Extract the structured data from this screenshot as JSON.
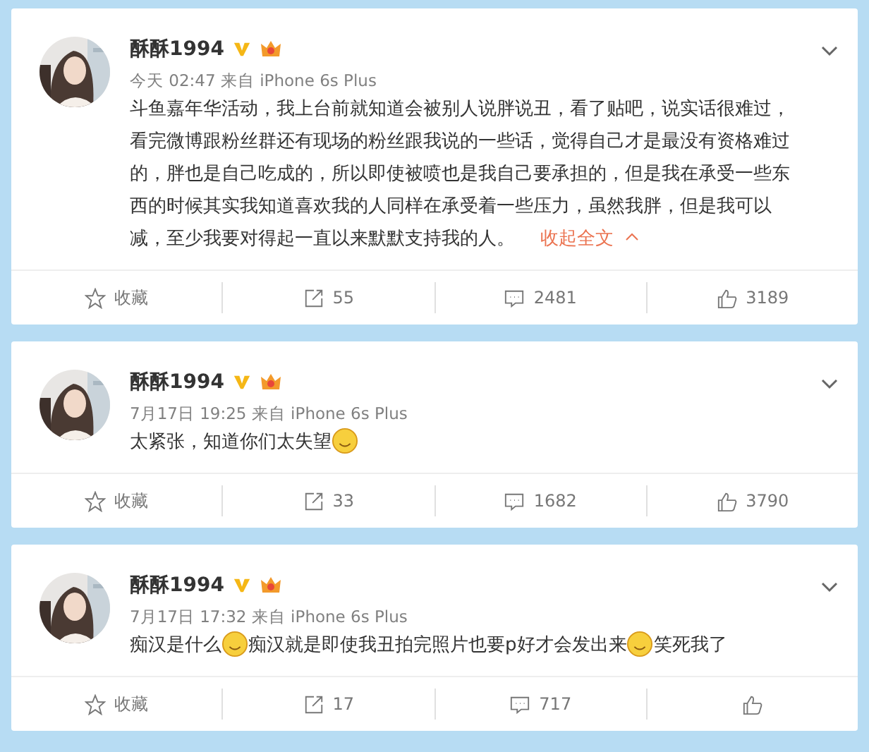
{
  "posts": [
    {
      "author": "酥酥1994",
      "time": "今天 02:47 来自 iPhone 6s Plus",
      "content": [
        {
          "kind": "text",
          "text": "斗鱼嘉年华活动，我上台前就知道会被别人说胖说丑，看了贴吧，说实话很难过，看完微博跟粉丝群还有现场的粉丝跟我说的一些话，觉得自己才是最没有资格难过的，胖也是自己吃成的，所以即使被喷也是我自己要承担的，但是我在承受一些东西的时候其实我知道喜欢我的人同样在承受着一些压力，虽然我胖，但是我可以减，至少我要对得起一直以来默默支持我的人。"
        }
      ],
      "collapse_link": "收起全文",
      "actions": {
        "favorite": "收藏",
        "reposts": "55",
        "comments": "2481",
        "likes": "3189"
      }
    },
    {
      "author": "酥酥1994",
      "time": "7月17日 19:25 来自 iPhone 6s Plus",
      "content": [
        {
          "kind": "text",
          "text": "太紧张，知道你们太失望"
        },
        {
          "kind": "emoji"
        }
      ],
      "actions": {
        "favorite": "收藏",
        "reposts": "33",
        "comments": "1682",
        "likes": "3790"
      }
    },
    {
      "author": "酥酥1994",
      "time": "7月17日 17:32 来自 iPhone 6s Plus",
      "content": [
        {
          "kind": "text",
          "text": "痴汉是什么"
        },
        {
          "kind": "emoji"
        },
        {
          "kind": "text",
          "text": "痴汉就是即使我丑拍完照片也要p好才会发出来"
        },
        {
          "kind": "emoji"
        },
        {
          "kind": "text",
          "text": "笑死我了"
        }
      ],
      "actions": {
        "favorite": "收藏",
        "reposts": "17",
        "comments": "717"
      }
    }
  ]
}
